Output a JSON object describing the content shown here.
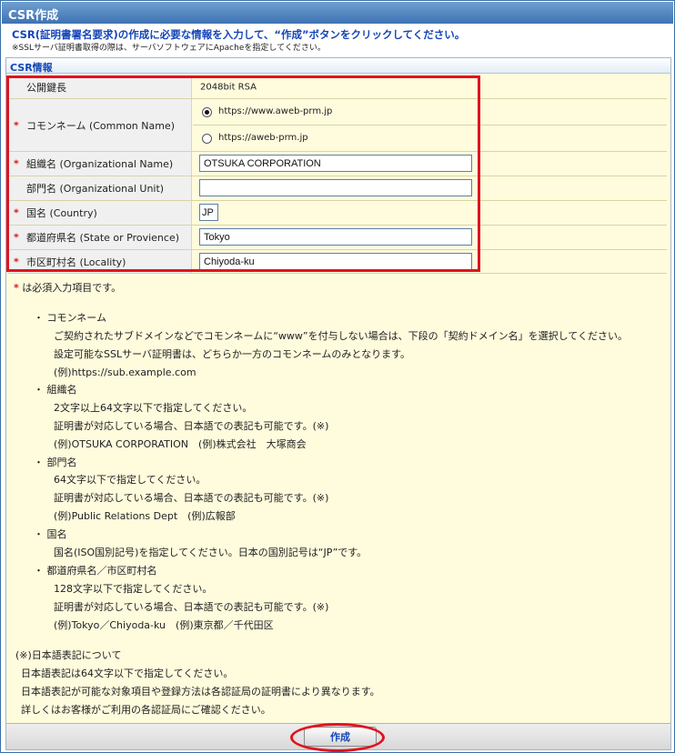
{
  "window": {
    "title": "CSR作成"
  },
  "intro": {
    "line1": "CSR(証明書署名要求)の作成に必要な情報を入力して、“作成”ボタンをクリックしてください。",
    "line2": "※SSLサーバ証明書取得の際は、サーバソフトウェアにApacheを指定してください。"
  },
  "section": {
    "title": "CSR情報"
  },
  "form": {
    "required_mark": "*",
    "key_length": {
      "label": "公開鍵長",
      "value": "2048bit RSA"
    },
    "common_name": {
      "label": "コモンネーム (Common Name)",
      "options": [
        {
          "label": "https://www.aweb-prm.jp",
          "checked": true
        },
        {
          "label": "https://aweb-prm.jp",
          "checked": false
        }
      ]
    },
    "organization": {
      "label": "組織名 (Organizational Name)",
      "value": "OTSUKA CORPORATION"
    },
    "org_unit": {
      "label": "部門名 (Organizational Unit)",
      "value": ""
    },
    "country": {
      "label": "国名 (Country)",
      "value": "JP"
    },
    "state": {
      "label": "都道府県名 (State or Provience)",
      "value": "Tokyo"
    },
    "locality": {
      "label": "市区町村名 (Locality)",
      "value": "Chiyoda-ku"
    }
  },
  "notes": {
    "required_note": "は必須入力項目です。",
    "common_name": {
      "title": "コモンネーム",
      "lines": [
        "ご契約されたサブドメインなどでコモンネームに“www”を付与しない場合は、下段の「契約ドメイン名」を選択してください。",
        "設定可能なSSLサーバ証明書は、どちらか一方のコモンネームのみとなります。",
        "(例)https://sub.example.com"
      ]
    },
    "organization": {
      "title": "組織名",
      "lines": [
        "2文字以上64文字以下で指定してください。",
        "証明書が対応している場合、日本語での表記も可能です。(※)",
        "(例)OTSUKA CORPORATION　(例)株式会社　大塚商会"
      ]
    },
    "org_unit": {
      "title": "部門名",
      "lines": [
        "64文字以下で指定してください。",
        "証明書が対応している場合、日本語での表記も可能です。(※)",
        "(例)Public Relations Dept　(例)広報部"
      ]
    },
    "country": {
      "title": "国名",
      "lines": [
        "国名(ISO国別記号)を指定してください。日本の国別記号は“JP”です。"
      ]
    },
    "state_locality": {
      "title": "都道府県名／市区町村名",
      "lines": [
        "128文字以下で指定してください。",
        "証明書が対応している場合、日本語での表記も可能です。(※)",
        "(例)Tokyo／Chiyoda-ku　(例)東京都／千代田区"
      ]
    },
    "japanese": {
      "title": "(※)日本語表記について",
      "lines": [
        "日本語表記は64文字以下で指定してください。",
        "日本語表記が可能な対象項目や登録方法は各認証局の証明書により異なります。",
        "詳しくはお客様がご利用の各認証局にご確認ください。"
      ]
    }
  },
  "actions": {
    "create_label": "作成"
  },
  "colors": {
    "accent": "#1446b8",
    "highlight": "#e0141e",
    "panel": "#fffbdd"
  }
}
